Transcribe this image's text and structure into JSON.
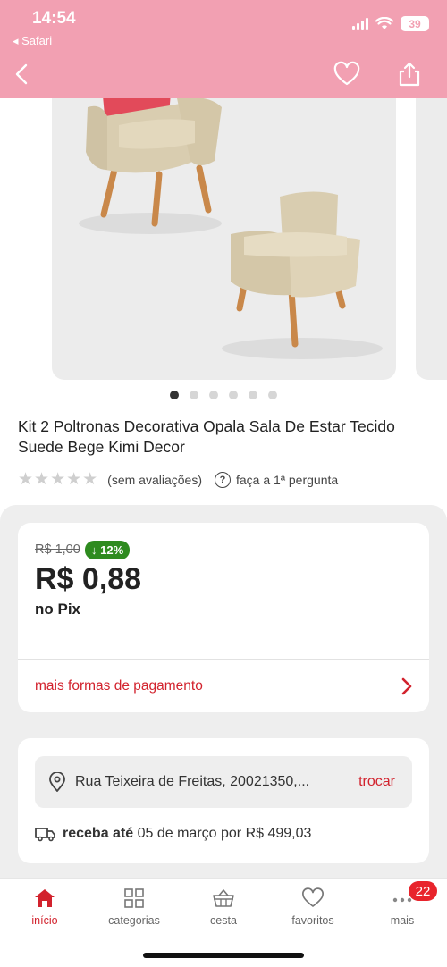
{
  "status_bar": {
    "time": "14:54",
    "back_app": "◂ Safari",
    "battery": "39"
  },
  "product": {
    "title": "Kit 2 Poltronas Decorativa Opala Sala De Estar Tecido Suede Bege Kimi Decor",
    "rating_text": "(sem avaliações)",
    "question_text": "faça a 1ª pergunta",
    "stars": "★★★★★",
    "gallery_dots": 6,
    "gallery_active": 0
  },
  "price": {
    "old": "R$ 1,00",
    "discount": "↓ 12%",
    "current": "R$ 0,88",
    "method": "no Pix",
    "more_payment": "mais formas de pagamento"
  },
  "shipping": {
    "address": "Rua Teixeira de Freitas, 20021350,...",
    "change": "trocar",
    "delivery_label": "receba até",
    "delivery_text": " 05 de março por R$ 499,03"
  },
  "tabs": [
    {
      "label": "início",
      "icon": "home-icon"
    },
    {
      "label": "categorias",
      "icon": "grid-icon"
    },
    {
      "label": "cesta",
      "icon": "basket-icon"
    },
    {
      "label": "favoritos",
      "icon": "heart-icon"
    },
    {
      "label": "mais",
      "icon": "more-icon"
    }
  ],
  "badge": "22",
  "colors": {
    "accent": "#d2222d",
    "discount": "#2e8b1f",
    "status_overlay": "#f2a0b2"
  }
}
